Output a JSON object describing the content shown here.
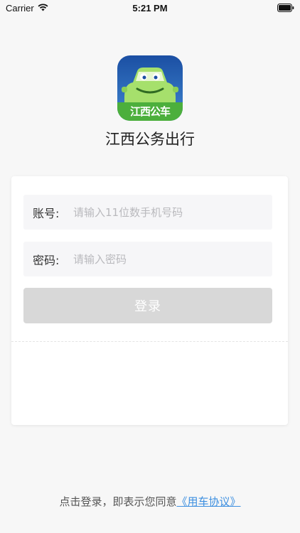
{
  "status_bar": {
    "carrier": "Carrier",
    "time": "5:21 PM"
  },
  "logo": {
    "text": "江西公车",
    "icon": "car-logo-icon",
    "colors": {
      "top": "#1e5fb0",
      "bottom": "#4caf3c",
      "car": "#a6e06c"
    }
  },
  "app_name": "江西公务出行",
  "form": {
    "account_label": "账号:",
    "account_placeholder": "请输入11位数手机号码",
    "password_label": "密码:",
    "password_placeholder": "请输入密码",
    "login_button": "登录"
  },
  "footer": {
    "agreement_text": "点击登录，即表示您同意",
    "agreement_link": "《用车协议》"
  },
  "colors": {
    "link": "#3d8fe0",
    "button_disabled": "#d8d8d8",
    "background": "#f7f7f7"
  }
}
